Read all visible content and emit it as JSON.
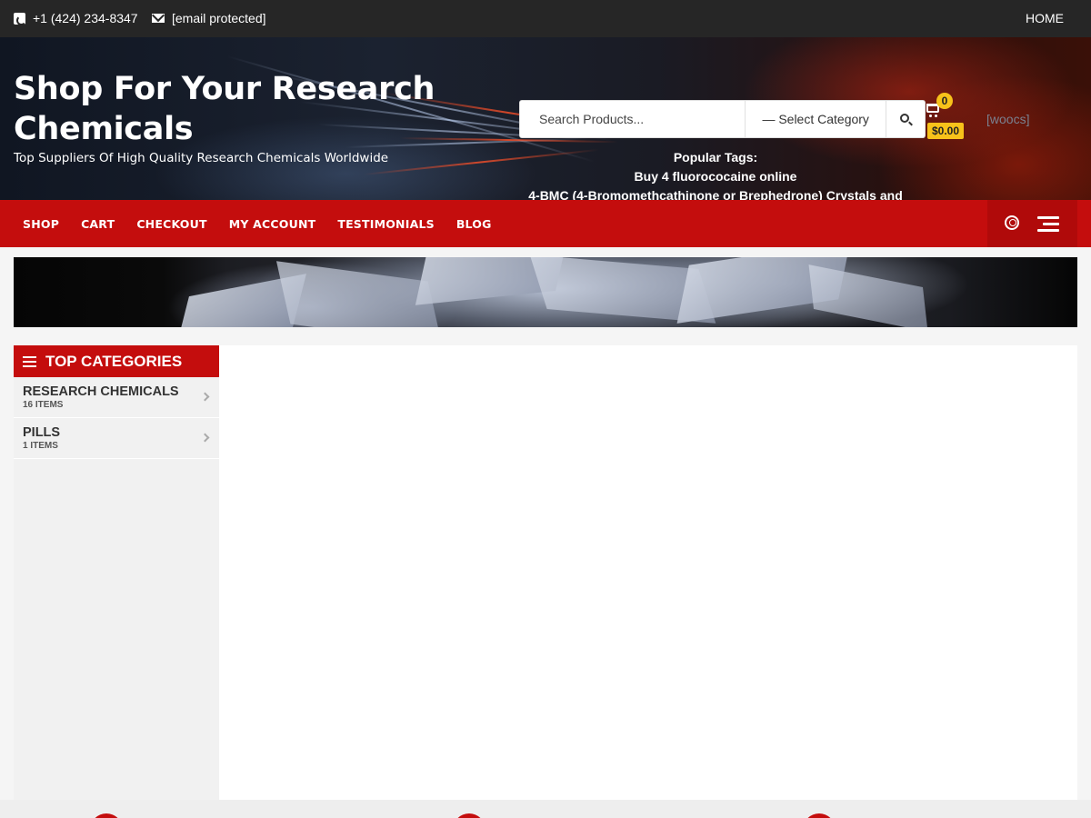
{
  "topbar": {
    "phone": "+1 (424) 234-8347",
    "email": "[email protected]",
    "home": "HOME"
  },
  "header": {
    "title": "Shop For Your Research Chemicals",
    "tagline": "Top Suppliers Of High Quality Research Chemicals Worldwide",
    "search_placeholder": "Search Products...",
    "category_select": "— Select Category",
    "cart_count": "0",
    "cart_total": "$0.00",
    "currency_shortcode": "[woocs]",
    "popular_tags_label": "Popular Tags:",
    "popular_tags": [
      "Buy 4 fluorococaine online",
      "4-BMC (4-Bromomethcathinone or Brephedrone) Crystals and"
    ]
  },
  "nav": {
    "items": [
      "SHOP",
      "CART",
      "CHECKOUT",
      "MY ACCOUNT",
      "TESTIMONIALS",
      "BLOG"
    ]
  },
  "sidebar": {
    "heading": "TOP CATEGORIES",
    "categories": [
      {
        "name": "RESEARCH CHEMICALS",
        "count": "16 ITEMS"
      },
      {
        "name": "PILLS",
        "count": "1 ITEMS"
      }
    ]
  },
  "colors": {
    "accent_red": "#c40d0d",
    "topbar_bg": "#262626",
    "badge_yellow": "#f7c21a"
  }
}
